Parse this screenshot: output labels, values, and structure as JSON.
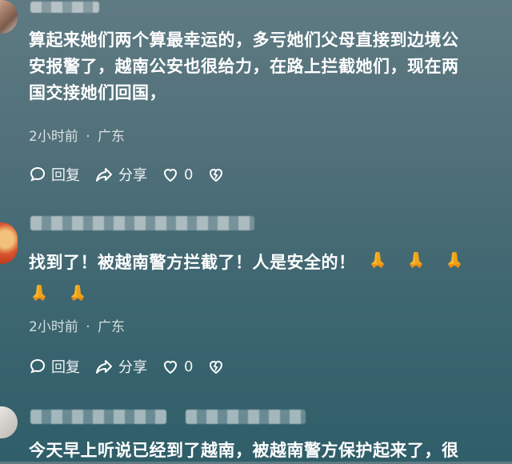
{
  "comments": [
    {
      "text_line1": "算起来她们两个算最幸运的，多亏她们父母直接到边境公",
      "text_line2": "安报警了，越南公安也很给力，在路上拦截她们，现在两",
      "text_line3": "国交接她们回国，",
      "time": "2小时前",
      "location": "广东",
      "reply_label": "回复",
      "share_label": "分享",
      "like_count": "0"
    },
    {
      "text_line1": "找到了！被越南警方拦截了！人是安全的！",
      "emoji_count": 5,
      "emoji_icon": "praying-hands-icon",
      "time": "2小时前",
      "location": "广东",
      "reply_label": "回复",
      "share_label": "分享",
      "like_count": "0"
    },
    {
      "text_line1": "今天早上听说已经到了越南，被越南警方保护起来了，很"
    }
  ],
  "meta_separator": "·",
  "icons": [
    "reply-bubble-icon",
    "share-arrow-icon",
    "heart-icon",
    "broken-heart-icon",
    "praying-hands-icon"
  ]
}
